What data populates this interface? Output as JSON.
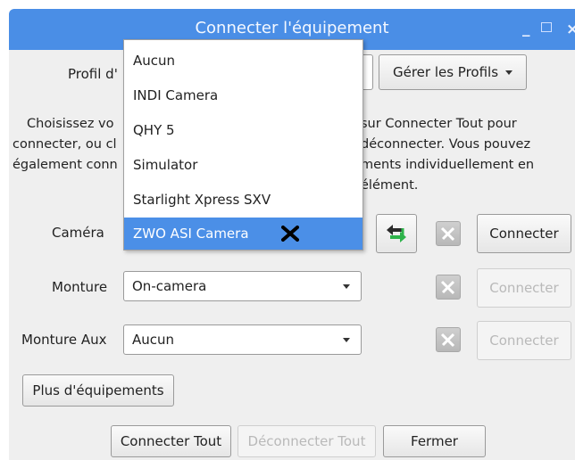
{
  "window": {
    "title": "Connecter l'équipement",
    "minimize_label": "_",
    "close_label": "×"
  },
  "profile": {
    "label_visible": "Profil d'",
    "manage_profiles_label": "Gérer les Profils"
  },
  "description": {
    "left_lines": [
      "Choisissez vo",
      "connecter, ou cl",
      "également conn"
    ],
    "right_lines": [
      "sur Connecter Tout pour",
      "déconnecter. Vous pouvez",
      "ments individuellement en",
      "élément."
    ]
  },
  "devices": [
    {
      "label": "Caméra",
      "connect_label": "Connecter",
      "connect_enabled": true
    },
    {
      "label": "Monture",
      "value": "On-camera",
      "connect_label": "Connecter",
      "connect_enabled": false
    },
    {
      "label": "Monture Aux",
      "value": "Aucun",
      "connect_label": "Connecter",
      "connect_enabled": false
    }
  ],
  "more_equipment_label": "Plus d'équipements",
  "footer": {
    "connect_all_label": "Connecter Tout",
    "disconnect_all_label": "Déconnecter Tout",
    "close_label": "Fermer"
  },
  "camera_dropdown": {
    "options": [
      "Aucun",
      "INDI Camera",
      "QHY 5",
      "Simulator",
      "Starlight Xpress SXV",
      "ZWO ASI Camera"
    ],
    "selected": "ZWO ASI Camera"
  },
  "colors": {
    "titlebar": "#4a8ee6",
    "selection": "#4b8fe7",
    "dialog_bg": "#efefef"
  },
  "icons": {
    "swap": "green-swap-arrows-icon",
    "tools": "tools-icon",
    "cursor": "x-cursor-icon"
  }
}
